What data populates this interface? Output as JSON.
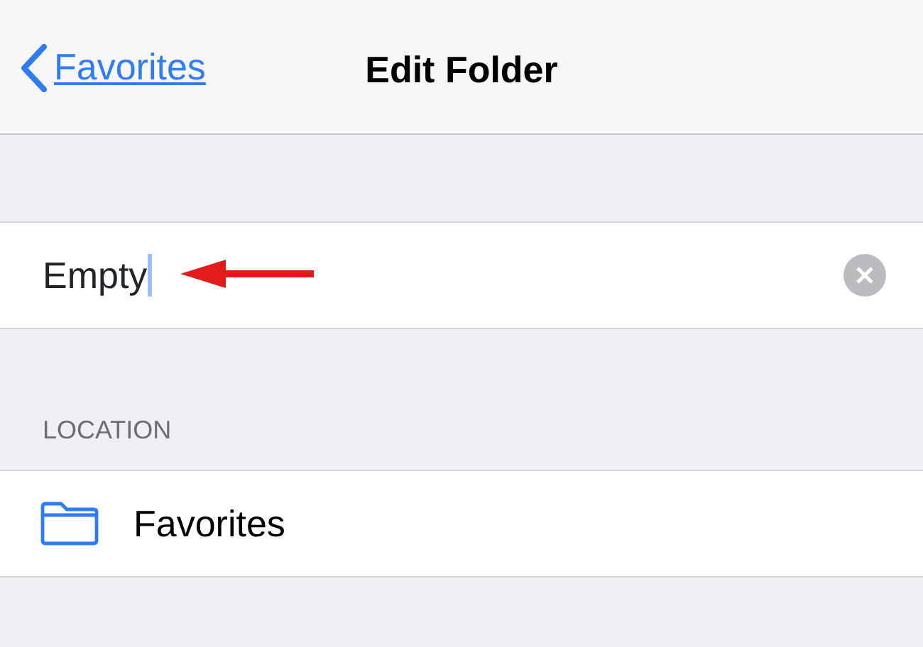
{
  "nav_bar": {
    "back_label": "Favorites",
    "title": "Edit Folder"
  },
  "name_field": {
    "value": "Empty",
    "focused": true
  },
  "location_section": {
    "header": "LOCATION",
    "items": [
      {
        "label": "Favorites"
      }
    ]
  }
}
